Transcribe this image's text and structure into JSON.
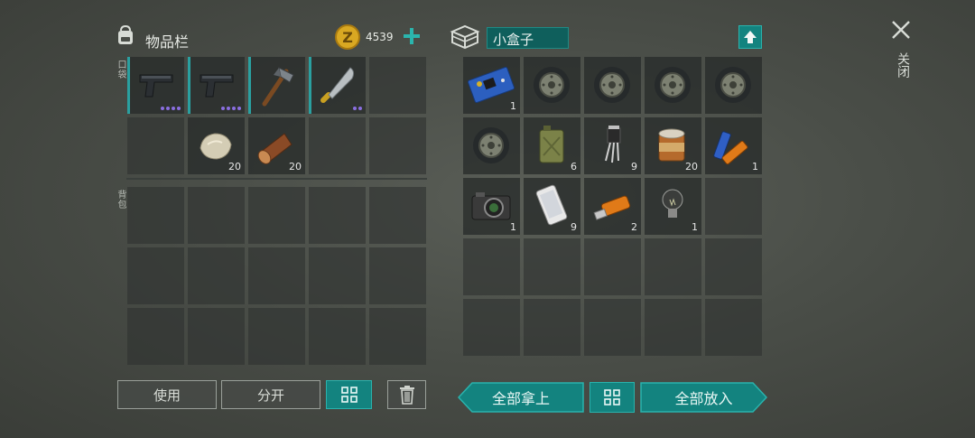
{
  "inventory": {
    "title": "物品栏",
    "coins": "4539",
    "pocket_label": "口袋",
    "backpack_label": "背包"
  },
  "container": {
    "name": "小盒子"
  },
  "pocket_items": [
    {
      "icon": "pistol-icon",
      "qty": "",
      "rarity_dots": 4
    },
    {
      "icon": "pistol-icon",
      "qty": "",
      "rarity_dots": 4
    },
    {
      "icon": "hatchet-icon",
      "qty": "",
      "rarity_dots": 0
    },
    {
      "icon": "machete-icon",
      "qty": "",
      "rarity_dots": 2
    },
    {
      "icon": "",
      "qty": ""
    },
    {
      "icon": "",
      "qty": ""
    },
    {
      "icon": "stone-icon",
      "qty": "20"
    },
    {
      "icon": "log-icon",
      "qty": "20"
    },
    {
      "icon": "",
      "qty": ""
    },
    {
      "icon": "",
      "qty": ""
    }
  ],
  "box_items": [
    {
      "icon": "circuit-board-icon",
      "qty": "1"
    },
    {
      "icon": "wheel-icon",
      "qty": ""
    },
    {
      "icon": "wheel-icon",
      "qty": ""
    },
    {
      "icon": "wheel-icon",
      "qty": ""
    },
    {
      "icon": "wheel-icon",
      "qty": ""
    },
    {
      "icon": "wheel-icon",
      "qty": ""
    },
    {
      "icon": "jerrycan-icon",
      "qty": "6"
    },
    {
      "icon": "transistor-icon",
      "qty": "9"
    },
    {
      "icon": "tin-can-icon",
      "qty": "20"
    },
    {
      "icon": "batteries-icon",
      "qty": "1"
    },
    {
      "icon": "camera-icon",
      "qty": "1"
    },
    {
      "icon": "smartphone-icon",
      "qty": "9"
    },
    {
      "icon": "usb-drive-icon",
      "qty": "2"
    },
    {
      "icon": "light-bulb-icon",
      "qty": "1"
    },
    {
      "icon": "",
      "qty": ""
    }
  ],
  "buttons": {
    "use": "使用",
    "split": "分开",
    "take_all": "全部拿上",
    "put_all": "全部放入",
    "close": "关闭"
  },
  "colors": {
    "accent": "#13837f",
    "accent_border": "#29b3ad",
    "rarity": "#8a6ee0",
    "coin": "#d9a822"
  }
}
